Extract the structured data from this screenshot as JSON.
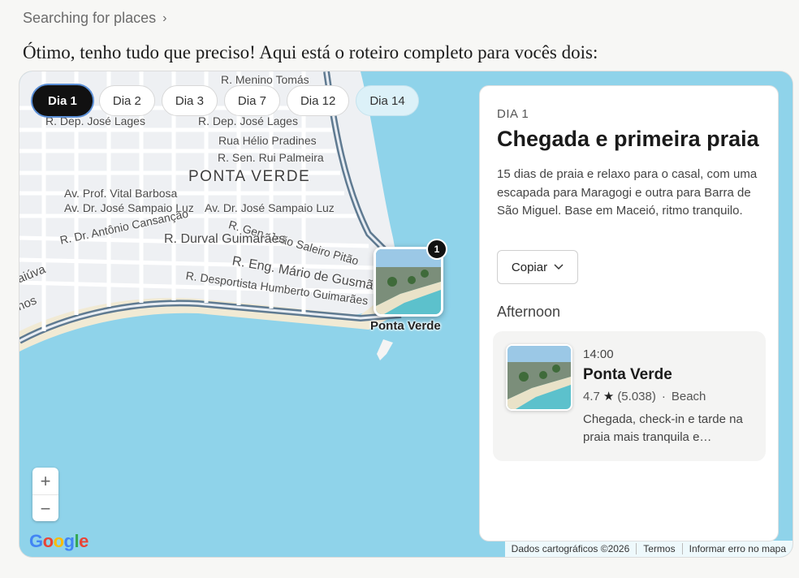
{
  "status": {
    "label": "Searching for places",
    "chevron_icon": "chevron-right-icon"
  },
  "intro": "Ótimo, tenho tudo que preciso! Aqui está o roteiro completo para vocês dois:",
  "tabs": [
    {
      "label": "Dia 1",
      "active": true
    },
    {
      "label": "Dia 2",
      "active": false
    },
    {
      "label": "Dia 3",
      "active": false
    },
    {
      "label": "Dia 7",
      "active": false
    },
    {
      "label": "Dia 12",
      "active": false
    },
    {
      "label": "Dia 14",
      "active": false
    }
  ],
  "map": {
    "streets": [
      "R. Menino Tomás",
      "R. Dep. José Lages",
      "R. Dep. José Lages",
      "Rua Hélio Pradines",
      "R. Sen. Rui Palmeira",
      "PONTA VERDE",
      "Av. Prof. Vital Barbosa",
      "Av. Dr. José Sampaio Luz",
      "Av. Dr. José Sampaio Luz",
      "R. Dr. Antônio Cansanção",
      "R. Gen. João Saleiro Pitão",
      "R. Durval Guimarães",
      "R. Eng. Mário de Gusmã",
      "R. Desportista Humberto Guimarães",
      "aiúva",
      "nos"
    ],
    "marker": {
      "label": "Ponta Verde",
      "badge": "1"
    },
    "zoom_in": "+",
    "zoom_out": "−",
    "logo": "Google",
    "attribution": [
      "Dados cartográficos ©2026",
      "Termos",
      "Informar erro no mapa"
    ],
    "colors": {
      "water": "#9fd7ea",
      "land": "#eef0f3",
      "road": "#ffffff",
      "shore": "#5f7a91"
    }
  },
  "panel": {
    "day": "DIA 1",
    "title": "Chegada e primeira praia",
    "description": "15 dias de praia e relaxo para o casal, com uma escapada para Maragogi e outra para Barra de São Miguel. Base em Maceió, ritmo tranquilo.",
    "copy_label": "Copiar",
    "section": "Afternoon",
    "item": {
      "time": "14:00",
      "name": "Ponta Verde",
      "rating": "4.7",
      "reviews": "(5.038)",
      "separator": "·",
      "category": "Beach",
      "description": "Chegada, check-in e tarde na praia mais tranquila e…"
    }
  }
}
